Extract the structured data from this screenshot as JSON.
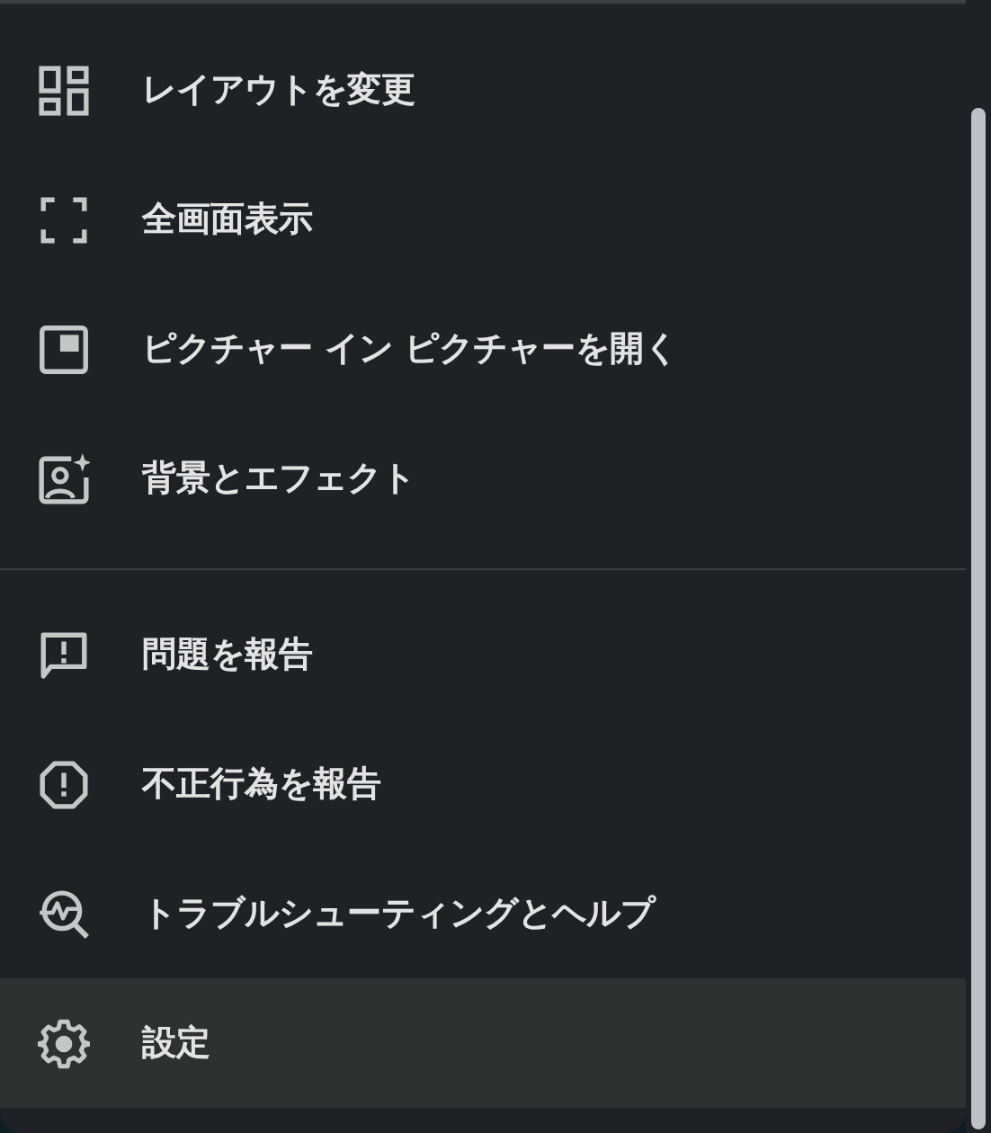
{
  "menu": {
    "groups": [
      {
        "items": [
          {
            "label": "レイアウトを変更",
            "selected": false
          },
          {
            "label": "全画面表示",
            "selected": false
          },
          {
            "label": "ピクチャー イン ピクチャーを開く",
            "selected": false
          },
          {
            "label": "背景とエフェクト",
            "selected": false
          }
        ]
      },
      {
        "items": [
          {
            "label": "問題を報告",
            "selected": false
          },
          {
            "label": "不正行為を報告",
            "selected": false
          },
          {
            "label": "トラブルシューティングとヘルプ",
            "selected": false
          },
          {
            "label": "設定",
            "selected": true
          }
        ]
      }
    ]
  }
}
